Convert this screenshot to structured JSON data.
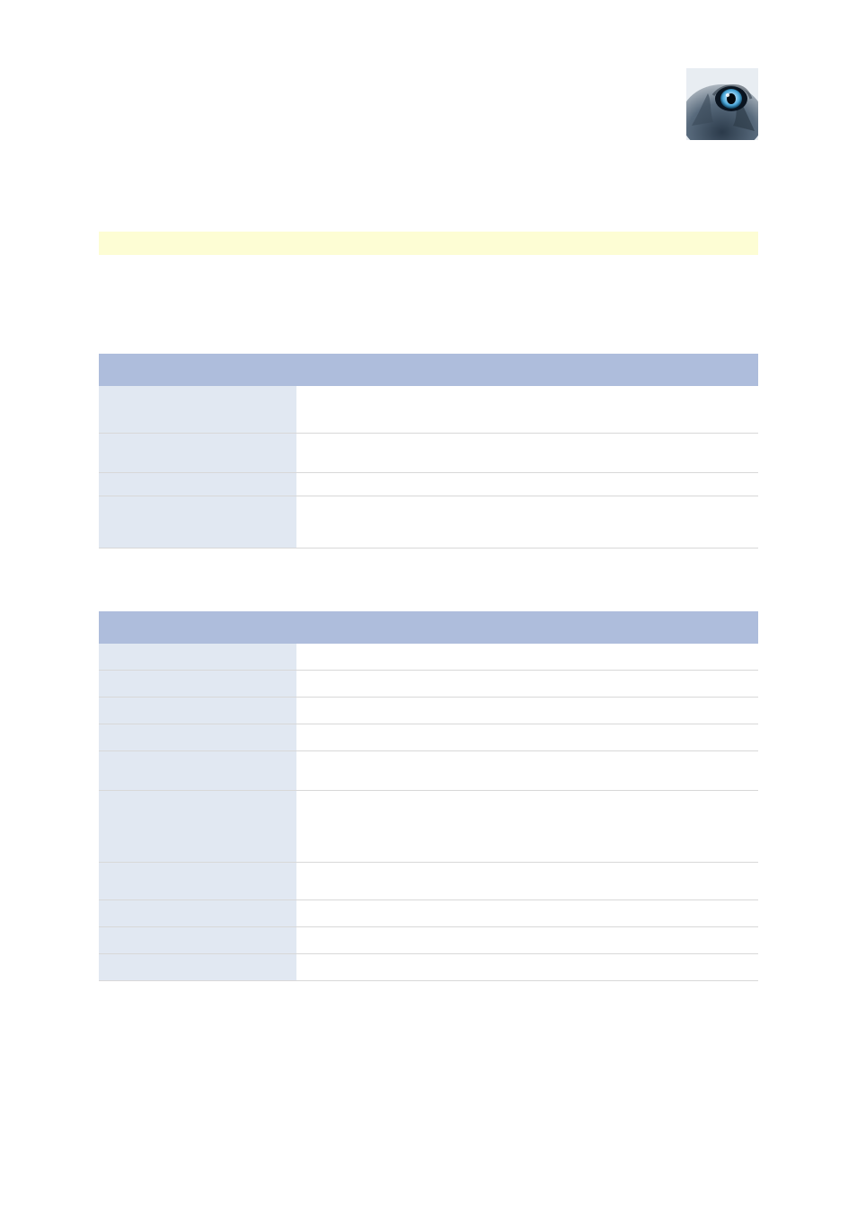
{
  "logo": {
    "name": "wolf-eye-logo"
  },
  "highlight": {
    "text": ""
  },
  "table1": {
    "headers": {
      "col1": "",
      "col2": ""
    },
    "rows": [
      {
        "label": "",
        "value": ""
      },
      {
        "label": "",
        "value": ""
      },
      {
        "label": "",
        "value": ""
      },
      {
        "label": "",
        "value": ""
      }
    ]
  },
  "table2": {
    "headers": {
      "col1": "",
      "col2": ""
    },
    "rows": [
      {
        "label": "",
        "value": ""
      },
      {
        "label": "",
        "value": ""
      },
      {
        "label": "",
        "value": ""
      },
      {
        "label": "",
        "value": ""
      },
      {
        "label": "",
        "value": ""
      },
      {
        "label": "",
        "value": ""
      },
      {
        "label": "",
        "value": ""
      },
      {
        "label": "",
        "value": ""
      },
      {
        "label": "",
        "value": ""
      },
      {
        "label": "",
        "value": ""
      }
    ]
  }
}
